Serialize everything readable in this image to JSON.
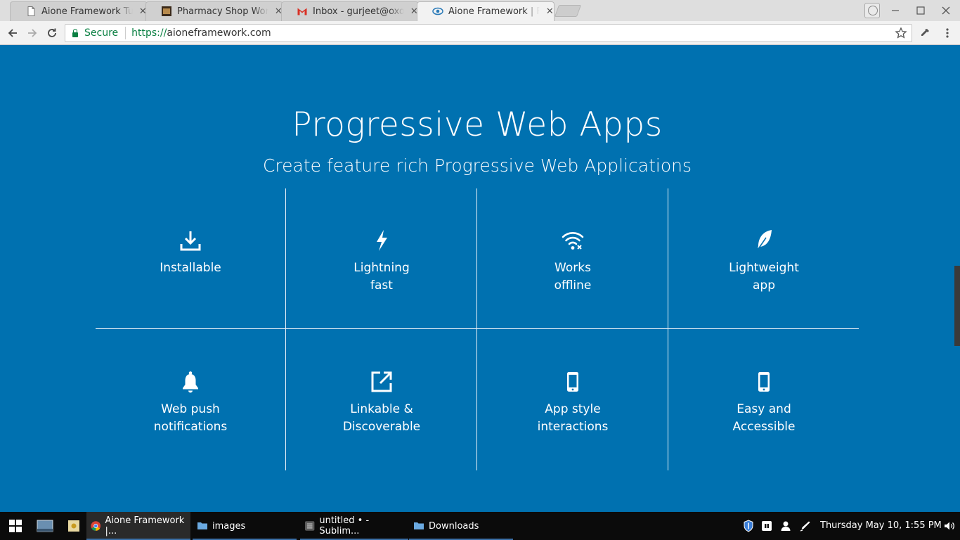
{
  "browser": {
    "tabs": [
      {
        "title": "Aione Framework Tutorials",
        "close": "✕",
        "active": false
      },
      {
        "title": "Pharmacy Shop WordPress Theme",
        "close": "✕",
        "active": false
      },
      {
        "title": "Inbox - gurjeet@oxosolutions.com",
        "close": "✕",
        "active": false
      },
      {
        "title": "Aione Framework | Responsive",
        "close": "✕",
        "active": true
      }
    ],
    "security_label": "Secure",
    "url_scheme": "https://",
    "url_host": "aioneframework.com"
  },
  "page": {
    "title": "Progressive Web Apps",
    "subtitle": "Create feature rich Progressive Web Applications",
    "features": [
      {
        "icon": "download-icon",
        "line1": "Installable",
        "line2": ""
      },
      {
        "icon": "lightning-icon",
        "line1": "Lightning",
        "line2": "fast"
      },
      {
        "icon": "wifi-off-icon",
        "line1": "Works",
        "line2": "offline"
      },
      {
        "icon": "feather-icon",
        "line1": "Lightweight",
        "line2": "app"
      },
      {
        "icon": "bell-icon",
        "line1": "Web push",
        "line2": "notifications"
      },
      {
        "icon": "external-link-icon",
        "line1": "Linkable &",
        "line2": "Discoverable"
      },
      {
        "icon": "mobile-icon",
        "line1": "App style",
        "line2": "interactions"
      },
      {
        "icon": "mobile-icon",
        "line1": "Easy and",
        "line2": "Accessible"
      }
    ]
  },
  "taskbar": {
    "items": [
      {
        "label": "Aione Framework |...",
        "active": true
      },
      {
        "label": "images",
        "active": false
      },
      {
        "label": "untitled • - Sublim...",
        "active": false
      },
      {
        "label": "Downloads",
        "active": false
      }
    ],
    "clock": "Thursday May 10,  1:55 PM"
  }
}
